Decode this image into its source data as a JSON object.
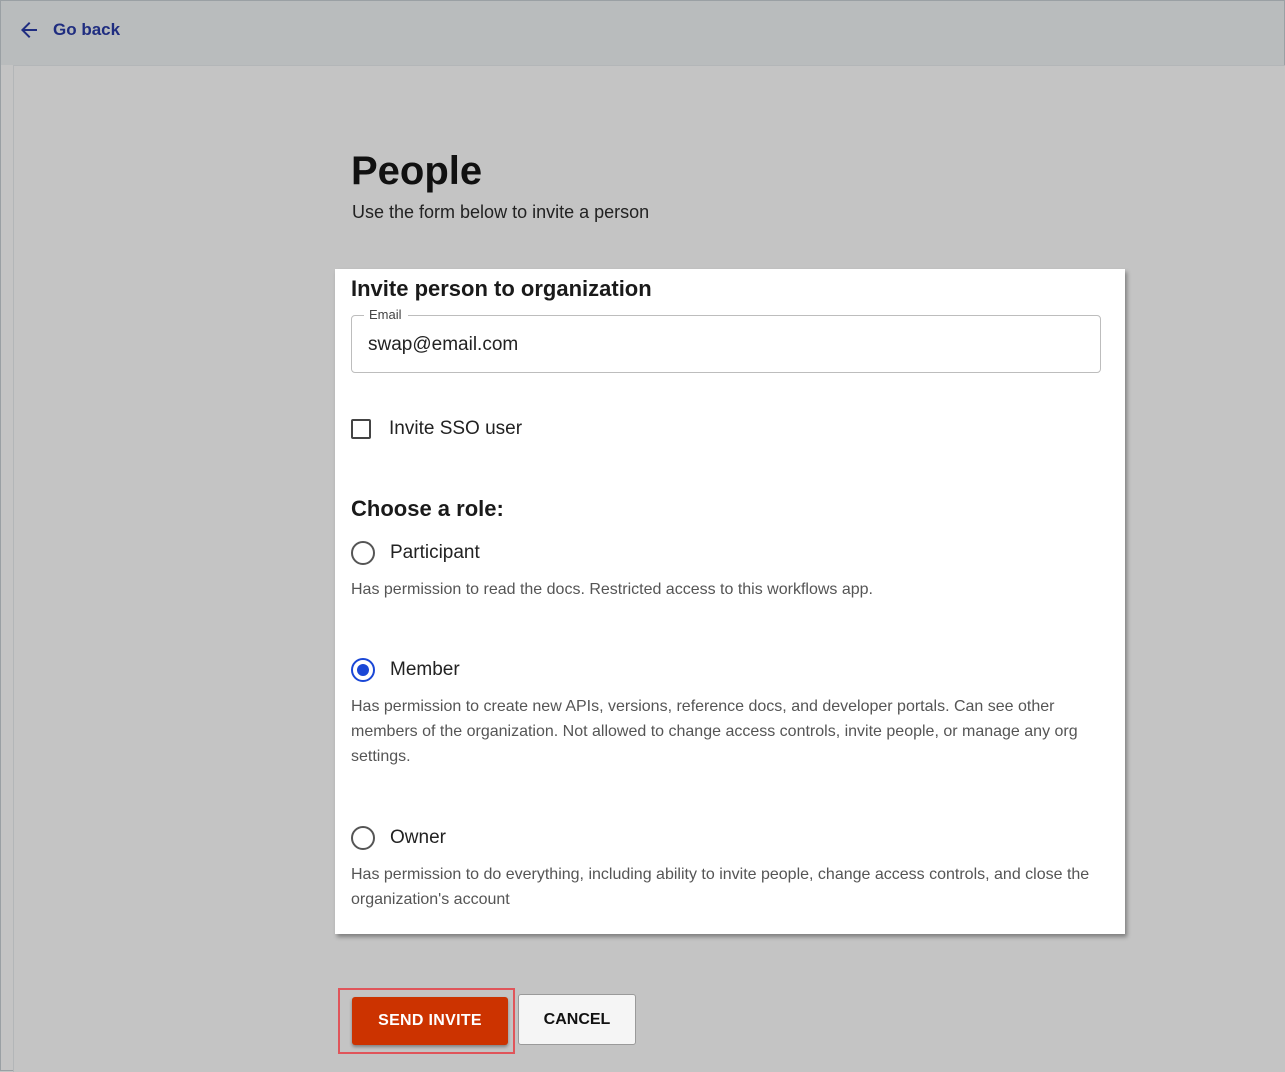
{
  "nav": {
    "go_back_label": "Go back",
    "go_back_icon": "arrow-left-icon",
    "link_color": "#1f2d80"
  },
  "page": {
    "title": "People",
    "subtitle": "Use the form below to invite a person"
  },
  "form": {
    "card_title": "Invite person to organization",
    "email": {
      "label": "Email",
      "value": "swap@email.com"
    },
    "sso": {
      "label": "Invite SSO user",
      "checked": false
    },
    "role_heading": "Choose a role:",
    "roles": [
      {
        "label": "Participant",
        "description": "Has permission to read the docs. Restricted access to this workflows app.",
        "selected": false
      },
      {
        "label": "Member",
        "description": "Has permission to create new APIs, versions, reference docs, and developer portals. Can see other members of the organization. Not allowed to change access controls, invite people, or manage any org settings.",
        "selected": true
      },
      {
        "label": "Owner",
        "description": "Has permission to do everything, including ability to invite people, change access controls, and close the organization's account",
        "selected": false
      }
    ]
  },
  "actions": {
    "send_label": "SEND INVITE",
    "cancel_label": "CANCEL",
    "send_color": "#cc3300",
    "radio_selected_color": "#1a47d6"
  }
}
